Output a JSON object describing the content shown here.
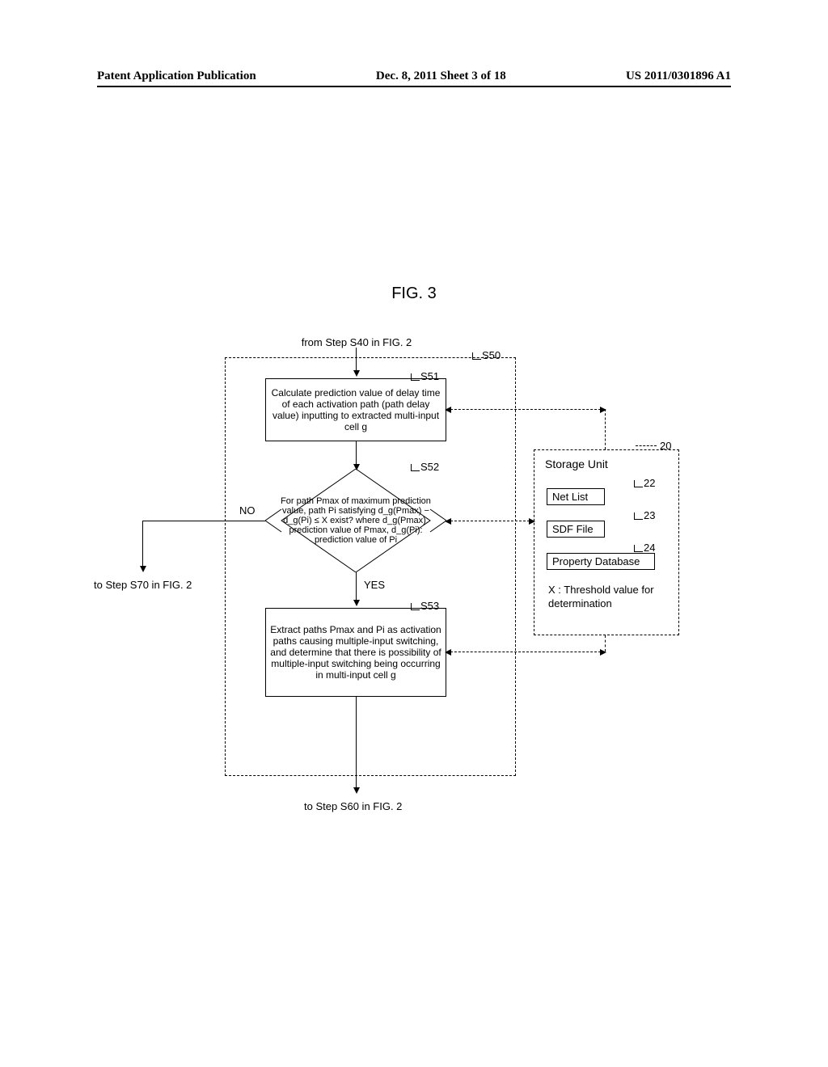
{
  "header": {
    "left": "Patent Application Publication",
    "center": "Dec. 8, 2011  Sheet 3 of 18",
    "right": "US 2011/0301896 A1"
  },
  "figure_title": "FIG. 3",
  "from_step": "from Step S40 in FIG. 2",
  "s50_label": "S50",
  "s51_label": "S51",
  "s51_text": "Calculate prediction value of delay time of each activation path (path delay value) inputting to extracted multi-input cell g",
  "s52_label": "S52",
  "s52_text": "For path Pmax of maximum prediction value, path Pi satisfying d_g(Pmax) − d_g(Pi) ≤ X exist? where d_g(Pmax): prediction value of Pmax, d_g(Pi): prediction value of Pi",
  "no_label": "NO",
  "yes_label": "YES",
  "to_s70": "to Step S70 in FIG. 2",
  "s53_label": "S53",
  "s53_text": "Extract paths Pmax and Pi as activation paths causing multiple-input switching, and determine that there is possibility of multiple-input switching being occurring in multi-input cell g",
  "to_s60": "to Step S60 in FIG. 2",
  "storage": {
    "ref": "20",
    "title": "Storage Unit",
    "items": {
      "i22": {
        "ref": "22",
        "label": "Net List"
      },
      "i23": {
        "ref": "23",
        "label": "SDF File"
      },
      "i24": {
        "ref": "24",
        "label": "Property Database"
      }
    },
    "threshold": "X : Threshold value for determination"
  }
}
